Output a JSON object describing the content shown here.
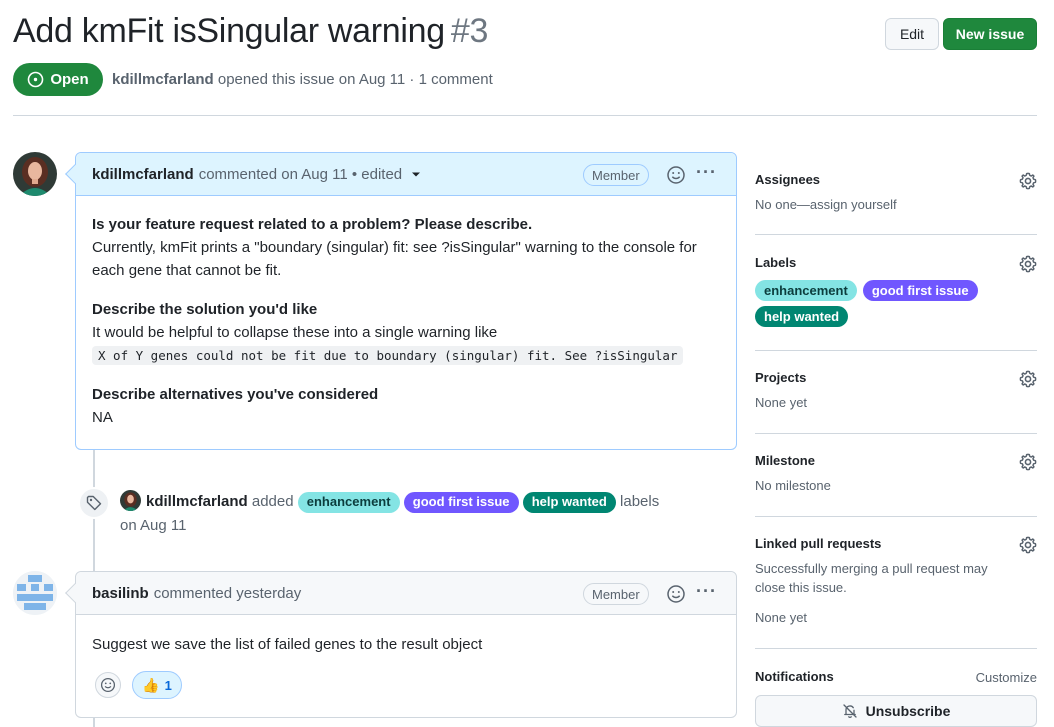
{
  "issue": {
    "title": "Add kmFit isSingular warning",
    "number": "#3",
    "state": "Open",
    "author": "kdillmcfarland",
    "opened_text": "opened this issue on Aug 11 · 1 comment"
  },
  "header_actions": {
    "edit_label": "Edit",
    "new_issue_label": "New issue"
  },
  "colors": {
    "open_green": "#1f883d",
    "label_enhancement": "#84e4e4",
    "label_good_first_issue": "#7057ff",
    "label_help_wanted": "#008672"
  },
  "comment1": {
    "author": "kdillmcfarland",
    "meta": "commented on Aug 11 • edited",
    "role": "Member",
    "sections": [
      {
        "heading": "Is your feature request related to a problem? Please describe.",
        "text": "Currently, kmFit prints a \"boundary (singular) fit: see ?isSingular\" warning to the console for each gene that cannot be fit."
      },
      {
        "heading": "Describe the solution you'd like",
        "text": "It would be helpful to collapse these into a single warning like",
        "code": "X of Y genes could not be fit due to boundary (singular) fit. See ?isSingular"
      },
      {
        "heading": "Describe alternatives you've considered",
        "text": "NA"
      }
    ]
  },
  "label_event": {
    "actor": "kdillmcfarland",
    "verb": "added",
    "labels": [
      "enhancement",
      "good first issue",
      "help wanted"
    ],
    "suffix": "labels",
    "date": "on Aug 11"
  },
  "comment2": {
    "author": "basilinb",
    "meta": "commented yesterday",
    "role": "Member",
    "text": "Suggest we save the list of failed genes to the result object",
    "reaction_icon": "thumbs-up",
    "reaction_count": "1"
  },
  "sidebar": {
    "assignees": {
      "title": "Assignees",
      "value": "No one—assign yourself"
    },
    "labels": {
      "title": "Labels",
      "items": [
        "enhancement",
        "good first issue",
        "help wanted"
      ]
    },
    "projects": {
      "title": "Projects",
      "value": "None yet"
    },
    "milestone": {
      "title": "Milestone",
      "value": "No milestone"
    },
    "linked_prs": {
      "title": "Linked pull requests",
      "description": "Successfully merging a pull request may close this issue.",
      "value": "None yet"
    },
    "notifications": {
      "title": "Notifications",
      "customize_label": "Customize",
      "unsubscribe_label": "Unsubscribe"
    }
  }
}
